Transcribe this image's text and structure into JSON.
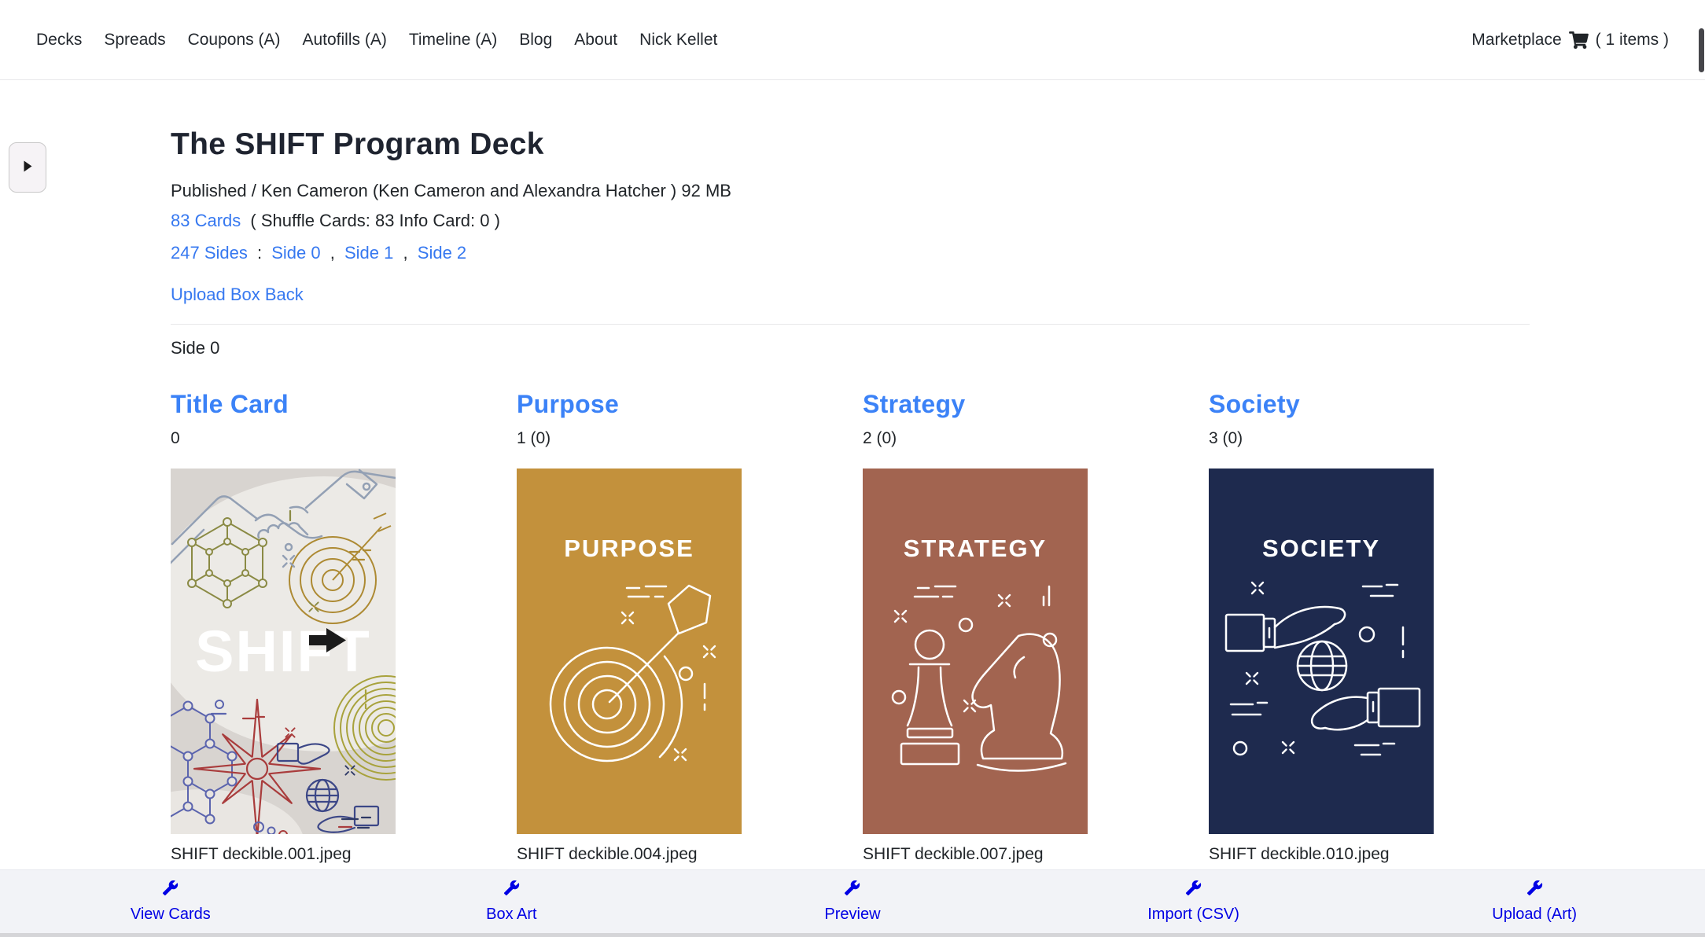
{
  "nav": {
    "items": [
      "Decks",
      "Spreads",
      "Coupons (A)",
      "Autofills (A)",
      "Timeline (A)",
      "Blog",
      "About",
      "Nick Kellet"
    ],
    "marketplace_label": "Marketplace",
    "cart_count": "( 1 items )"
  },
  "deck": {
    "title": "The SHIFT Program Deck",
    "meta": "Published / Ken Cameron (Ken Cameron and Alexandra Hatcher ) 92 MB",
    "cards_link": "83 Cards",
    "cards_detail": "( Shuffle Cards: 83 Info Card: 0 )",
    "sides_link": "247 Sides",
    "sep_colon": ":",
    "sep_comma": ",",
    "sides": [
      "Side 0",
      "Side 1",
      "Side 2"
    ],
    "upload_link": "Upload Box Back",
    "section_label": "Side 0"
  },
  "cards": [
    {
      "title": "Title Card",
      "count": "0",
      "caption": "SHIFT deckible.001.jpeg",
      "bg": "#d8d4d0",
      "label": "SHIFT"
    },
    {
      "title": "Purpose",
      "count": "1 (0)",
      "caption": "SHIFT deckible.004.jpeg",
      "bg": "#c3913c",
      "label": "PURPOSE"
    },
    {
      "title": "Strategy",
      "count": "2 (0)",
      "caption": "SHIFT deckible.007.jpeg",
      "bg": "#a26450",
      "label": "STRATEGY"
    },
    {
      "title": "Society",
      "count": "3 (0)",
      "caption": "SHIFT deckible.010.jpeg",
      "bg": "#1e2a4e",
      "label": "SOCIETY"
    }
  ],
  "toolbar": {
    "items": [
      "View Cards",
      "Box Art",
      "Preview",
      "Import (CSV)",
      "Upload (Art)"
    ]
  },
  "icons": {
    "cart": "shopping-cart-icon",
    "wrench": "wrench-icon",
    "sidebar_toggle": "chevron-right-icon"
  },
  "colors": {
    "link_blue": "#3678f0",
    "card_title_blue": "#3b82f7",
    "toolbar_accent": "#0000e4",
    "text_dark": "#212529"
  }
}
